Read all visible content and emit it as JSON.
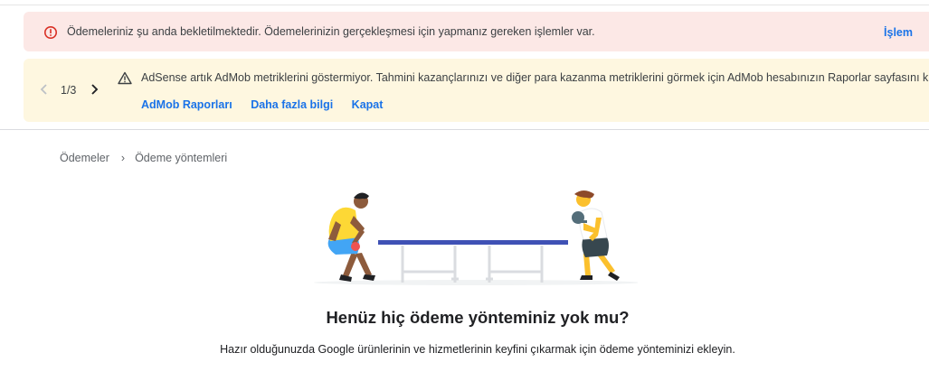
{
  "alert": {
    "message": "Ödemeleriniz şu anda bekletilmektedir. Ödemelerinizin gerçekleşmesi için yapmanız gereken işlemler var.",
    "action_label": "İşlem",
    "icon": "error-icon",
    "color": "#fce8e6"
  },
  "notice": {
    "pager": "1/3",
    "icon": "warning-icon",
    "message": "AdSense artık AdMob metriklerini göstermiyor. Tahmini kazançlarınızı ve diğer para kazanma metriklerini görmek için AdMob hesabınızın Raporlar sayfasını kullanın.",
    "links": [
      "AdMob Raporları",
      "Daha fazla bilgi",
      "Kapat"
    ],
    "color": "#fef7e0"
  },
  "breadcrumb": {
    "items": [
      "Ödemeler",
      "Ödeme yöntemleri"
    ]
  },
  "empty_state": {
    "title": "Henüz hiç ödeme yönteminiz yok mu?",
    "description": "Hazır olduğunuzda Google ürünlerinin ve hizmetlerinin keyfini çıkarmak için ödeme yönteminizi ekleyin."
  },
  "colors": {
    "accent": "#1a73e8",
    "error": "#d93025"
  }
}
